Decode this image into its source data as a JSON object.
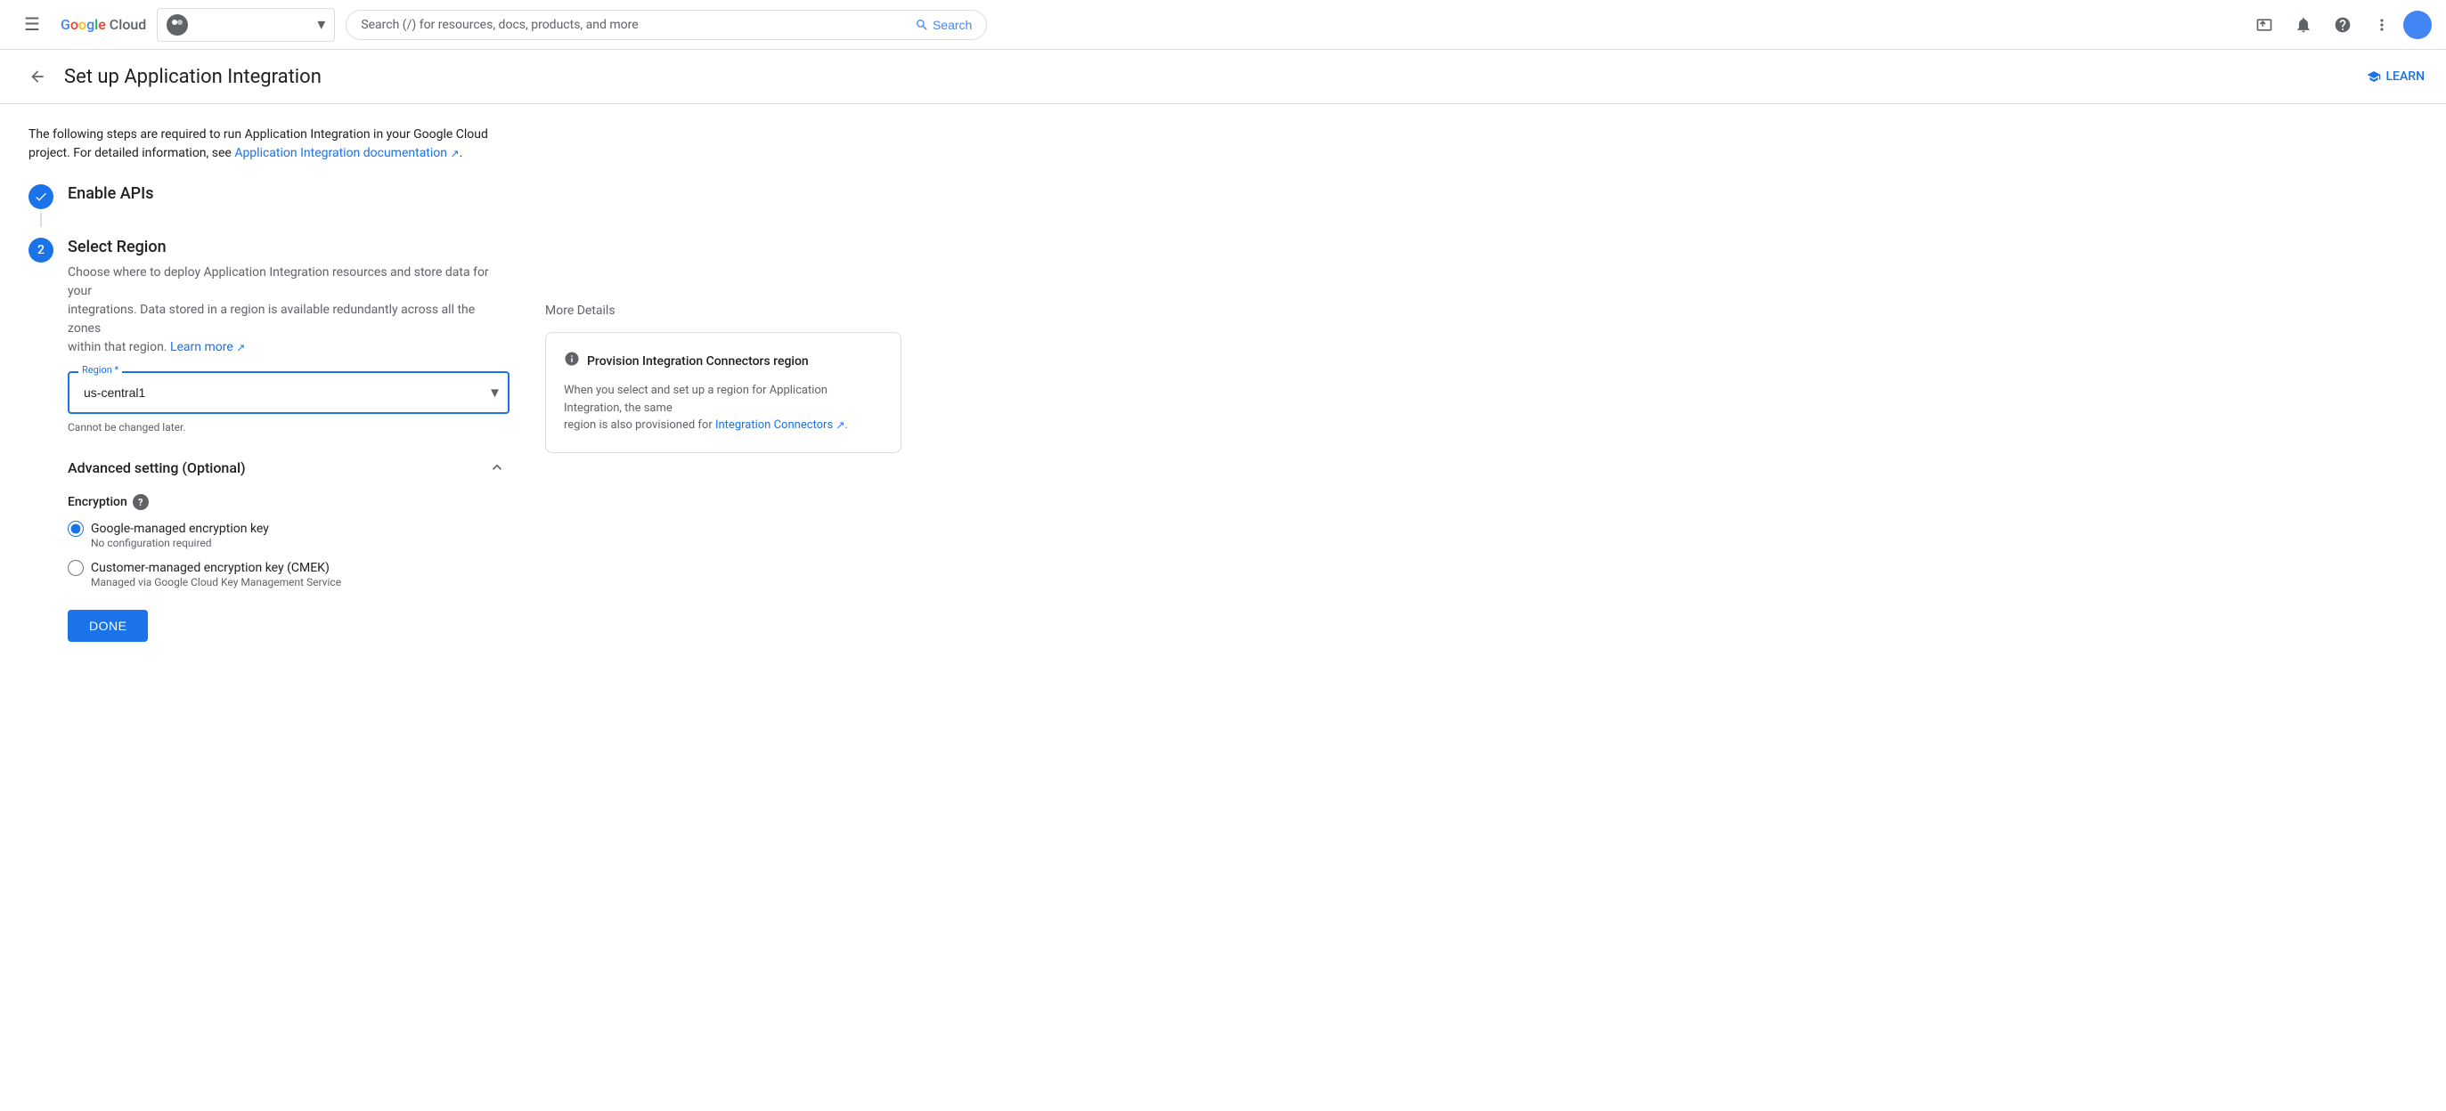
{
  "topbar": {
    "hamburger_label": "☰",
    "logo_letters": [
      "G",
      "o",
      "o",
      "g",
      "l",
      "e"
    ],
    "logo_cloud": " Cloud",
    "project_avatar": "●",
    "search_placeholder": "Search (/) for resources, docs, products, and more",
    "search_button_label": "Search",
    "icons": {
      "terminal": "⬛",
      "bell": "🔔",
      "help": "?",
      "more": "⋮"
    }
  },
  "subheader": {
    "back_arrow": "←",
    "page_title": "Set up Application Integration",
    "learn_label": "LEARN"
  },
  "intro": {
    "text1": "The following steps are required to run Application Integration in your Google Cloud",
    "text2": "project. For detailed information, see ",
    "link_text": "Application Integration documentation",
    "text3": "."
  },
  "steps": {
    "step1": {
      "title": "Enable APIs",
      "number": "✓"
    },
    "step2": {
      "number": "2",
      "title": "Select Region",
      "description1": "Choose where to deploy Application Integration resources and store data for your",
      "description2": "integrations. Data stored in a region is available redundantly across all the zones",
      "description3": "within that region. ",
      "learn_more": "Learn more",
      "region_label": "Region *",
      "region_value": "us-central1",
      "cannot_change": "Cannot be changed later.",
      "advanced_title": "Advanced setting (Optional)",
      "encryption_label": "Encryption",
      "option1_label": "Google-managed encryption key",
      "option1_desc": "No configuration required",
      "option2_label": "Customer-managed encryption key (CMEK)",
      "option2_desc": "Managed via Google Cloud Key Management Service",
      "done_label": "DONE"
    }
  },
  "right_panel": {
    "more_details": "More Details",
    "card_title": "Provision Integration Connectors region",
    "card_body1": "When you select and set up a region for Application Integration, the same",
    "card_body2": "region is also provisioned for ",
    "card_link": "Integration Connectors",
    "card_body3": "."
  },
  "colors": {
    "blue": "#1a73e8",
    "text_dark": "#202124",
    "text_light": "#5f6368",
    "border": "#dadce0"
  }
}
